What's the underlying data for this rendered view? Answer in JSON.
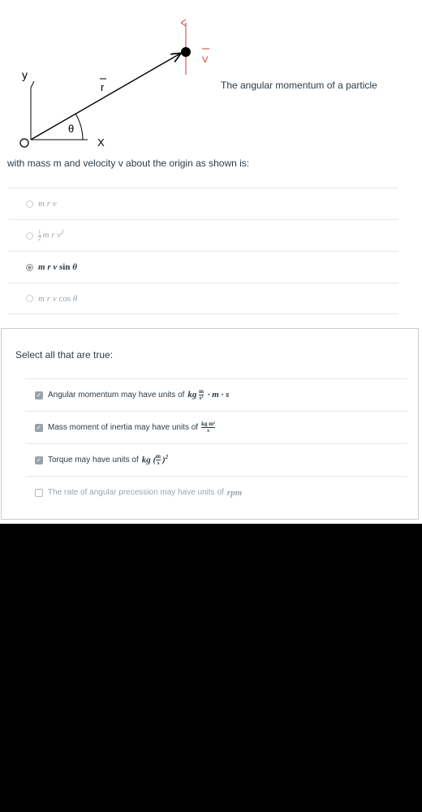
{
  "diagram": {
    "labels": {
      "y": "y",
      "x": "X",
      "origin": "O",
      "theta": "θ",
      "r": "r",
      "v": "V"
    },
    "colors": {
      "vector_v": "#e03030",
      "particle": "#000000",
      "lines": "#000000"
    }
  },
  "question1": {
    "text_right": "The angular momentum of a particle",
    "text_cont": "with mass m and velocity v about the origin as shown is:",
    "answers": [
      {
        "tokens": [
          "m",
          "r",
          "v"
        ],
        "selected": false
      },
      {
        "prefix_frac": [
          "1",
          "2"
        ],
        "tokens": [
          "m",
          "r",
          "v"
        ],
        "power": "2",
        "selected": false
      },
      {
        "tokens": [
          "m",
          "r",
          "v"
        ],
        "fn": "sin",
        "arg": "θ",
        "selected": true
      },
      {
        "tokens": [
          "m",
          "r",
          "v"
        ],
        "fn": "cos",
        "arg": "θ",
        "selected": false
      }
    ]
  },
  "question2": {
    "prompt": "Select all that are true:",
    "items": [
      {
        "text": "Angular momentum may have units of",
        "unit_pre": "kg",
        "unit_frac": [
          "m",
          "s²"
        ],
        "unit_post": "· m · s",
        "checked": true
      },
      {
        "text": "Mass moment of inertia may have units of",
        "unit_frac": [
          "kg m²",
          "s"
        ],
        "checked": true
      },
      {
        "text": "Torque may have units of",
        "unit_pre": "kg",
        "unit_paren_frac": [
          "m",
          "s"
        ],
        "unit_power": "2",
        "checked": true
      },
      {
        "text": "The rate of angular precession may have units of",
        "unit_pre": "rpm",
        "checked": false
      }
    ]
  }
}
